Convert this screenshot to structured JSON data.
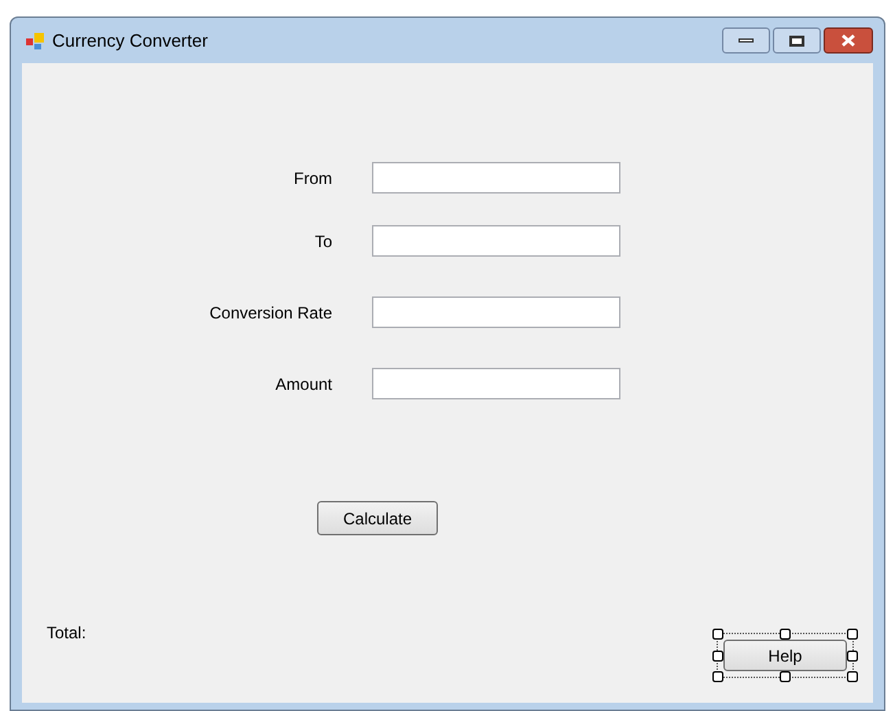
{
  "window": {
    "title": "Currency Converter"
  },
  "fields": [
    {
      "label": "From"
    },
    {
      "label": "To"
    },
    {
      "label": "Conversion Rate"
    },
    {
      "label": "Amount"
    }
  ],
  "calculate_button": {
    "label": "Calculate"
  },
  "total_label": "Total:",
  "help_button": {
    "label": "Help",
    "selected": true
  }
}
